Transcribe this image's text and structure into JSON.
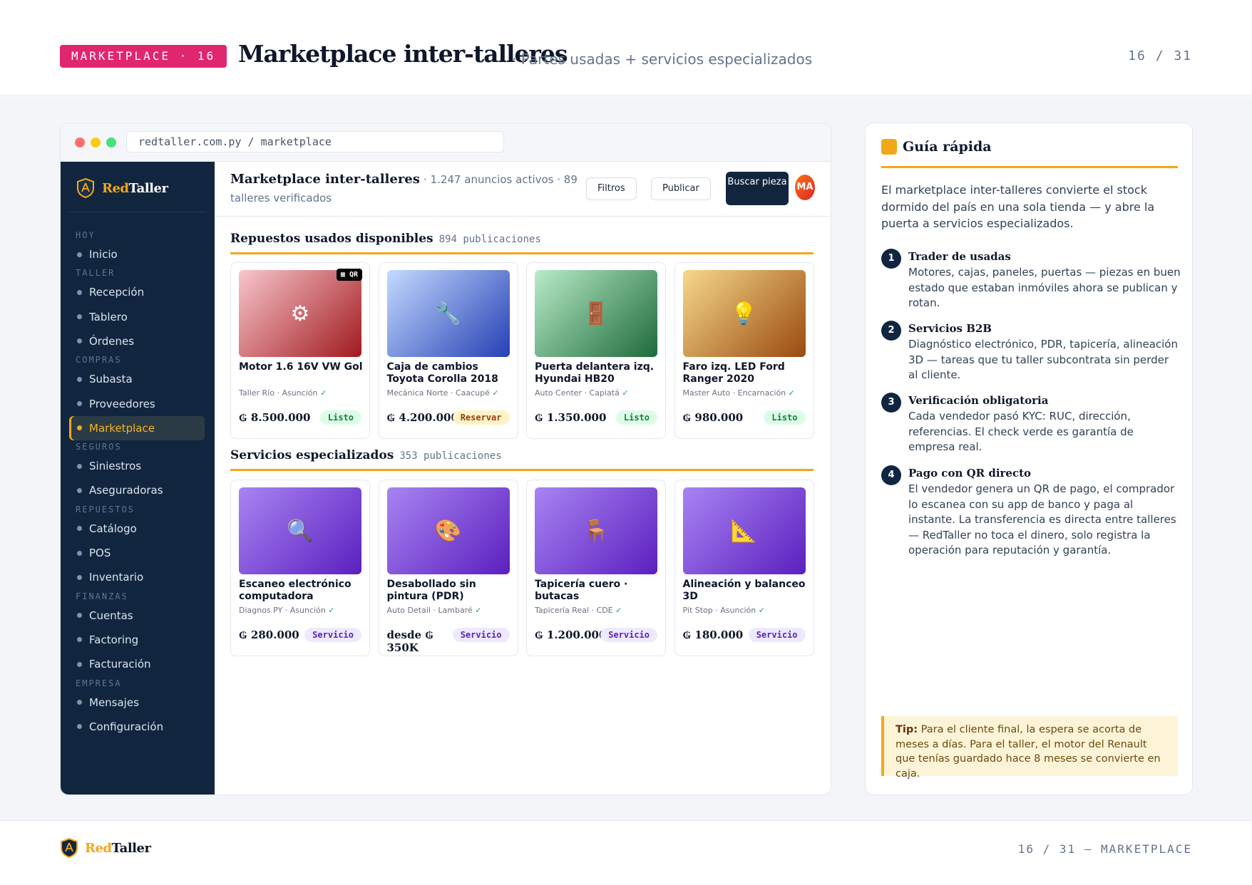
{
  "header": {
    "tag": "MARKETPLACE · 16",
    "title": "Marketplace inter-talleres",
    "subtitle": "· Partes usadas + servicios especializados",
    "counter": "16 / 31"
  },
  "browser": {
    "url": "redtaller.com.py / marketplace"
  },
  "brand": {
    "red": "Red",
    "taller": "Taller"
  },
  "sidebar": {
    "sections": [
      {
        "label": "HOY",
        "items": [
          "Inicio"
        ]
      },
      {
        "label": "TALLER",
        "items": [
          "Recepción",
          "Tablero",
          "Órdenes"
        ]
      },
      {
        "label": "COMPRAS",
        "items": [
          "Subasta",
          "Proveedores",
          "Marketplace"
        ]
      },
      {
        "label": "SEGUROS",
        "items": [
          "Siniestros",
          "Aseguradoras"
        ]
      },
      {
        "label": "REPUESTOS",
        "items": [
          "Catálogo",
          "POS",
          "Inventario"
        ]
      },
      {
        "label": "FINANZAS",
        "items": [
          "Cuentas",
          "Factoring",
          "Facturación"
        ]
      },
      {
        "label": "EMPRESA",
        "items": [
          "Mensajes",
          "Configuración"
        ]
      }
    ],
    "active_item": "Marketplace"
  },
  "topbar": {
    "title": "Marketplace inter-talleres",
    "stats": "· 1.247 anuncios activos · 89 talleres verificados",
    "filters_label": "Filtros",
    "publish_label": "Publicar",
    "search_label": "Buscar pieza",
    "avatar_initials": "MA"
  },
  "used_parts": {
    "title": "Repuestos usados disponibles",
    "count": "894 publicaciones",
    "cards": [
      {
        "title": "Motor 1.6 16V VW Gol",
        "seller": "Taller Río · Asunción",
        "price": "₲ 8.500.000",
        "status": "Listo",
        "status_kind": "listo",
        "icon": "gear-icon",
        "glyph": "⚙",
        "badge": "▦ QR"
      },
      {
        "title": "Caja de cambios Toyota Corolla 2018",
        "seller": "Mecánica Norte · Caacupé",
        "price": "₲ 4.200.000",
        "status": "Reservar",
        "status_kind": "reservar",
        "icon": "wrench-icon",
        "glyph": "🔧"
      },
      {
        "title": "Puerta delantera izq. Hyundai HB20",
        "seller": "Auto Center · Capiatá",
        "price": "₲ 1.350.000",
        "status": "Listo",
        "status_kind": "listo",
        "icon": "door-icon",
        "glyph": "🚪"
      },
      {
        "title": "Faro izq. LED Ford Ranger 2020",
        "seller": "Master Auto · Encarnación",
        "price": "₲ 980.000",
        "status": "Listo",
        "status_kind": "listo",
        "icon": "light-bulb-icon",
        "glyph": "💡"
      }
    ]
  },
  "services": {
    "title": "Servicios especializados",
    "count": "353 publicaciones",
    "cards": [
      {
        "title": "Escaneo electrónico computadora",
        "seller": "Diagnos PY · Asunción",
        "price": "₲ 280.000",
        "status": "Servicio",
        "status_kind": "servicio",
        "icon": "magnifier-icon",
        "glyph": "🔍"
      },
      {
        "title": "Desabollado sin pintura (PDR)",
        "seller": "Auto Detail · Lambaré",
        "price": "desde ₲ 350K",
        "status": "Servicio",
        "status_kind": "servicio",
        "icon": "palette-icon",
        "glyph": "🎨"
      },
      {
        "title": "Tapicería cuero · butacas",
        "seller": "Tapicería Real · CDE",
        "price": "₲ 1.200.000",
        "status": "Servicio",
        "status_kind": "servicio",
        "icon": "chair-icon",
        "glyph": "🪑"
      },
      {
        "title": "Alineación y balanceo 3D",
        "seller": "Pit Stop · Asunción",
        "price": "₲ 180.000",
        "status": "Servicio",
        "status_kind": "servicio",
        "icon": "ruler-icon",
        "glyph": "📐"
      }
    ]
  },
  "guide": {
    "title": "Guía rápida",
    "intro": "El marketplace inter-talleres convierte el stock dormido del país en una sola tienda — y abre la puerta a servicios especializados.",
    "steps": [
      {
        "num": "1",
        "title": "Trader de usadas",
        "body": "Motores, cajas, paneles, puertas — piezas en buen estado que estaban inmóviles ahora se publican y rotan."
      },
      {
        "num": "2",
        "title": "Servicios B2B",
        "body": "Diagnóstico electrónico, PDR, tapicería, alineación 3D — tareas que tu taller subcontrata sin perder al cliente."
      },
      {
        "num": "3",
        "title": "Verificación obligatoria",
        "body": "Cada vendedor pasó KYC: RUC, dirección, referencias. El check verde es garantía de empresa real."
      },
      {
        "num": "4",
        "title": "Pago con QR directo",
        "body": "El vendedor genera un QR de pago, el comprador lo escanea con su app de banco y paga al instante. La transferencia es directa entre talleres — RedTaller no toca el dinero, solo registra la operación para reputación y garantía."
      }
    ],
    "tip_label": "Tip:",
    "tip_text": "Para el cliente final, la espera se acorta de meses a días. Para el taller, el motor del Renault que tenías guardado hace 8 meses se convierte en caja."
  },
  "footer": {
    "counter": "16 / 31 — MARKETPLACE"
  },
  "colors": {
    "accent": "#f2a71b",
    "tag": "#e0266e",
    "navy": "#11263e",
    "listo": "#15803d",
    "servicio": "#5b21b6"
  }
}
